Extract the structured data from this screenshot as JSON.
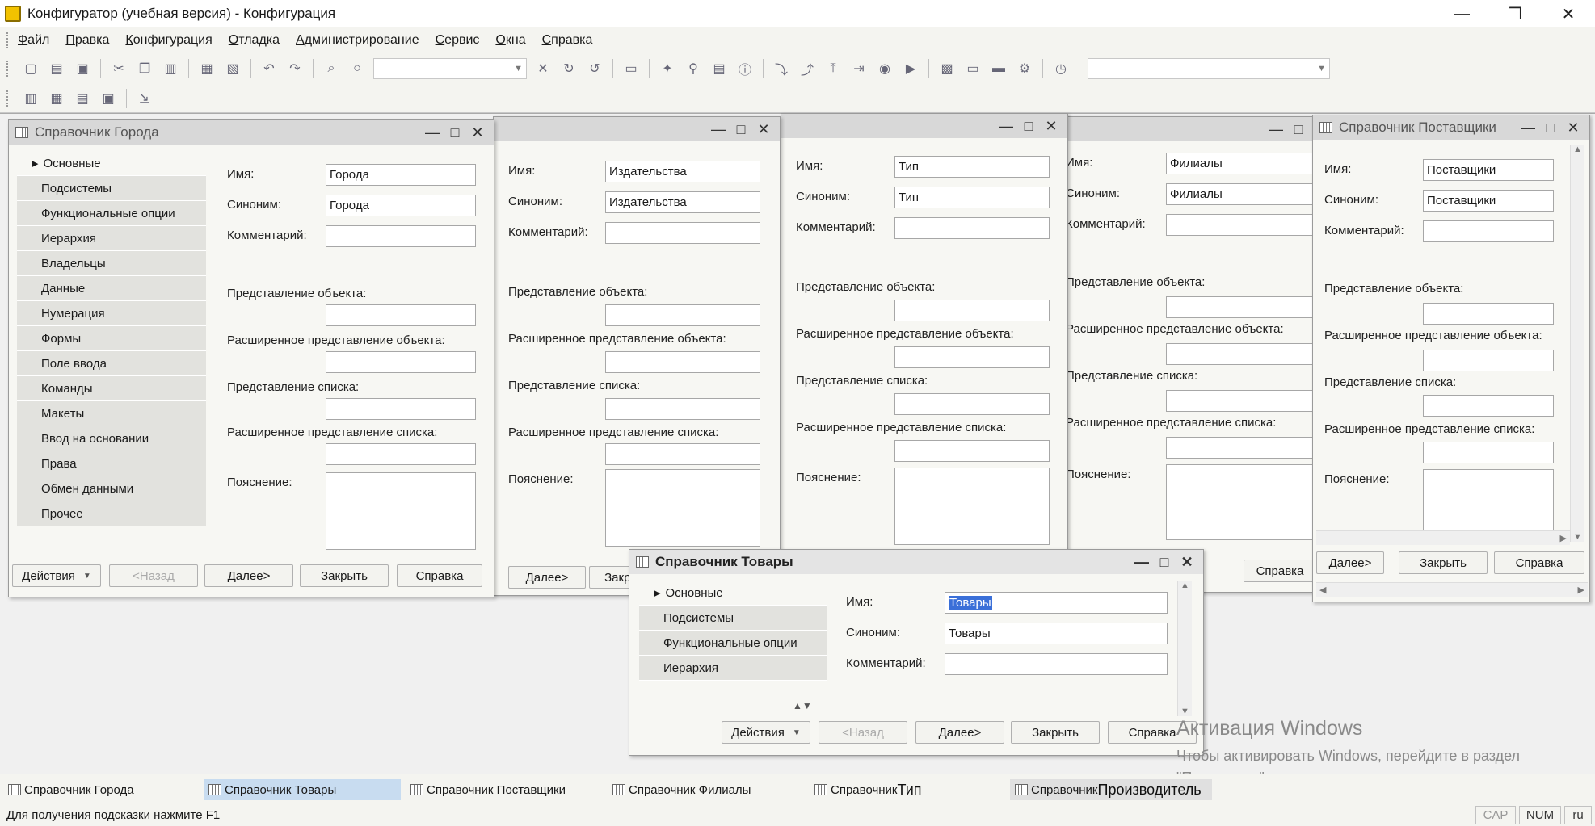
{
  "app": {
    "title": "Конфигуратор (учебная версия) - Конфигурация",
    "win_min": "—",
    "win_restore": "❐",
    "win_close": "✕"
  },
  "menu": [
    "Файл",
    "Правка",
    "Конфигурация",
    "Отладка",
    "Администрирование",
    "Сервис",
    "Окна",
    "Справка"
  ],
  "labels": {
    "name": "Имя:",
    "synonym": "Синоним:",
    "comment": "Комментарий:",
    "obj_repr": "Представление объекта:",
    "ext_obj_repr": "Расширенное представление объекта:",
    "list_repr": "Представление списка:",
    "ext_list_repr": "Расширенное представление списка:",
    "explanation": "Пояснение:"
  },
  "buttons": {
    "actions": "Действия",
    "back": "<Назад",
    "next": "Далее>",
    "close": "Закрыть",
    "help": "Справка"
  },
  "sidebar_full": [
    "Основные",
    "Подсистемы",
    "Функциональные опции",
    "Иерархия",
    "Владельцы",
    "Данные",
    "Нумерация",
    "Формы",
    "Поле ввода",
    "Команды",
    "Макеты",
    "Ввод на основании",
    "Права",
    "Обмен данными",
    "Прочее"
  ],
  "sidebar_short": [
    "Основные",
    "Подсистемы",
    "Функциональные опции",
    "Иерархия"
  ],
  "windows": {
    "goroda": {
      "title": "Справочник Города",
      "name": "Города",
      "synonym": "Города"
    },
    "izdatelstva": {
      "name": "Издательства",
      "synonym": "Издательства"
    },
    "tip": {
      "name": "Тип",
      "synonym": "Тип"
    },
    "filialy": {
      "name": "Филиалы",
      "synonym": "Филиалы"
    },
    "postavshiki": {
      "title": "Справочник Поставщики",
      "name": "Поставщики",
      "synonym": "Поставщики"
    },
    "tovary": {
      "title": "Справочник Товары",
      "name": "Товары",
      "synonym": "Товары"
    }
  },
  "watermark": {
    "title": "Активация Windows",
    "text": "Чтобы активировать Windows, перейдите в раздел \"Параметры\"."
  },
  "taskbar": [
    {
      "prefix": "Справочник Города",
      "suffix": ""
    },
    {
      "prefix": "Справочник Товары",
      "suffix": ""
    },
    {
      "prefix": "Справочник Поставщики",
      "suffix": ""
    },
    {
      "prefix": "Справочник Филиалы",
      "suffix": ""
    },
    {
      "prefix": "Справочник",
      "suffix": "Тип"
    },
    {
      "prefix": "Справочник",
      "suffix": "Производитель"
    }
  ],
  "status": {
    "hint": "Для получения подсказки нажмите F1",
    "cap": "CAP",
    "num": "NUM",
    "lang": "ru"
  }
}
